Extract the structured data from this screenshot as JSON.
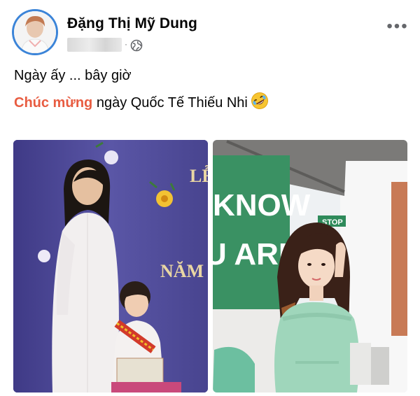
{
  "post": {
    "author_name": "Đặng Thị Mỹ Dung",
    "meta_separator": "·",
    "text_line1": "Ngày ấy ... bây giờ",
    "text_line2_highlight": "Chúc mừng",
    "text_line2_rest": " ngày Quốc Tế Thiếu Nhi",
    "more_label": "•••"
  },
  "photos": {
    "left": {
      "banner_text_1": "LỄ",
      "banner_text_2": "NĂM"
    },
    "right": {
      "wall_text_1": "KNOW",
      "wall_text_2": "U ARE?",
      "sign_text": "STOP"
    }
  },
  "icons": {
    "visibility": "globe-icon",
    "emoji": "rolling-on-floor-laughing-emoji",
    "more": "more-options-icon"
  },
  "colors": {
    "highlight": "#e85c41",
    "avatar_ring": "#3b84d8",
    "meta_gray": "#65676b"
  }
}
